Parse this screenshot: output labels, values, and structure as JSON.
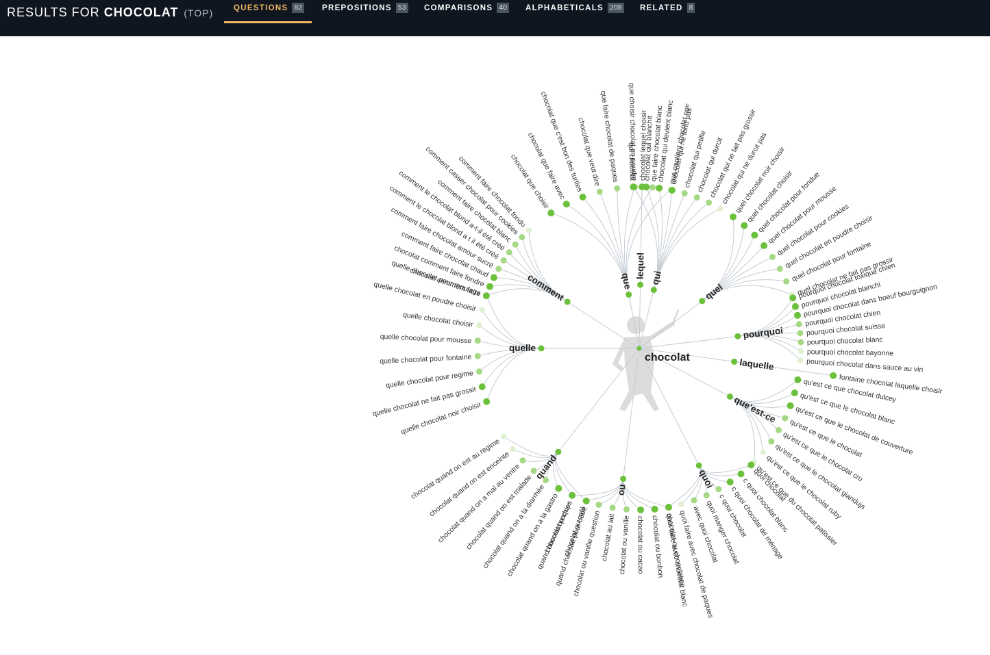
{
  "header": {
    "title_prefix": "RESULTS FOR",
    "query": "CHOCOLAT",
    "mode": "(TOP)",
    "tabs": [
      {
        "label": "QUESTIONS",
        "count": "82",
        "active": true
      },
      {
        "label": "PREPOSITIONS",
        "count": "53",
        "active": false
      },
      {
        "label": "COMPARISONS",
        "count": "40",
        "active": false
      },
      {
        "label": "ALPHABETICALS",
        "count": "208",
        "active": false
      },
      {
        "label": "RELATED",
        "count": "8",
        "active": false
      }
    ]
  },
  "colors": {
    "header_bg": "#0f1620",
    "accent": "#f4b863",
    "node_strong": "#6cc13c",
    "node_medium": "#a5d883",
    "node_light": "#e0f1d2",
    "link": "#c4cbd2"
  },
  "wheel": {
    "root": "chocolat",
    "branches": [
      {
        "label": "que",
        "leaves": [
          {
            "text": "chocolat que choisir",
            "strength": 1
          },
          {
            "text": "chocolat que faire avec",
            "strength": 1
          },
          {
            "text": "chocolat que c'est bon des turtles",
            "strength": 1
          },
          {
            "text": "chocolat que veut dire",
            "strength": 2
          },
          {
            "text": "que faire chocolat de paques",
            "strength": 2
          },
          {
            "text": "que choisir chocolat en poudre",
            "strength": 2
          },
          {
            "text": "que faire chocolat blanc",
            "strength": 2
          },
          {
            "text": "que contient chocolat noir",
            "strength": 3
          }
        ]
      },
      {
        "label": "lequel",
        "leaves": [
          {
            "text": "chocolat lequel choisir",
            "strength": 1
          }
        ]
      },
      {
        "label": "qui",
        "leaves": [
          {
            "text": "qui chocolat",
            "strength": 1
          },
          {
            "text": "chocolat qui blanchit",
            "strength": 1
          },
          {
            "text": "chocolat qui devient blanc",
            "strength": 1
          },
          {
            "text": "chocolat qui ne fond pas",
            "strength": 1
          },
          {
            "text": "chocolat qui petille",
            "strength": 2
          },
          {
            "text": "chocolat qui durcit",
            "strength": 2
          },
          {
            "text": "chocolat qui ne fait pas grossir",
            "strength": 2
          },
          {
            "text": "chocolat qui ne durcit pas",
            "strength": 3
          }
        ]
      },
      {
        "label": "quel",
        "leaves": [
          {
            "text": "quel chocolat noir choisir",
            "strength": 1
          },
          {
            "text": "quel chocolat choisir",
            "strength": 1
          },
          {
            "text": "quel chocolat pour fondue",
            "strength": 1
          },
          {
            "text": "quel chocolat pour mousse",
            "strength": 1
          },
          {
            "text": "quel chocolat pour cookies",
            "strength": 2
          },
          {
            "text": "quel chocolat en poudre choisir",
            "strength": 2
          },
          {
            "text": "quel chocolat pour fontaine",
            "strength": 2
          },
          {
            "text": "quel chocolat ne fait pas grossir",
            "strength": 3
          }
        ]
      },
      {
        "label": "pourquoi",
        "leaves": [
          {
            "text": "pourquoi chocolat toxique chien",
            "strength": 1
          },
          {
            "text": "pourquoi chocolat blanchi",
            "strength": 1
          },
          {
            "text": "pourquoi chocolat dans boeuf bourguignon",
            "strength": 1
          },
          {
            "text": "pourquoi chocolat chien",
            "strength": 2
          },
          {
            "text": "pourquoi chocolat suisse",
            "strength": 2
          },
          {
            "text": "pourquoi chocolat blanc",
            "strength": 2
          },
          {
            "text": "pourquoi chocolat bayonne",
            "strength": 3
          },
          {
            "text": "pourquoi chocolat dans sauce au vin",
            "strength": 3
          }
        ]
      },
      {
        "label": "laquelle",
        "leaves": [
          {
            "text": "fontaine chocolat laquelle choisir",
            "strength": 1
          }
        ]
      },
      {
        "label": "que'est-ce",
        "leaves": [
          {
            "text": "qu'est ce que chocolat dulcey",
            "strength": 1
          },
          {
            "text": "qu'est ce que le chocolat blanc",
            "strength": 1
          },
          {
            "text": "qu'est ce que le chocolat de couverture",
            "strength": 1
          },
          {
            "text": "qu'est ce que le chocolat",
            "strength": 2
          },
          {
            "text": "qu'est ce que le chocolat cru",
            "strength": 2
          },
          {
            "text": "qu'est ce que le chocolat gianduja",
            "strength": 2
          },
          {
            "text": "qu'est ce que le chocolat ruby",
            "strength": 3
          },
          {
            "text": "qu'est ce que du chocolat patissier",
            "strength": 3
          }
        ]
      },
      {
        "label": "quoi",
        "leaves": [
          {
            "text": "quoi chocolat",
            "strength": 1
          },
          {
            "text": "c quoi chocolat blanc",
            "strength": 1
          },
          {
            "text": "c quoi chocolat de ménage",
            "strength": 1
          },
          {
            "text": "c quoi chocolat",
            "strength": 2
          },
          {
            "text": "quoi manger chocolat",
            "strength": 2
          },
          {
            "text": "avec quoi chocolat",
            "strength": 2
          },
          {
            "text": "quoi faire avec chocolat de paques",
            "strength": 3
          },
          {
            "text": "quoi faire avec chocolat blanc",
            "strength": 3
          }
        ]
      },
      {
        "label": "ou",
        "leaves": [
          {
            "text": "chocolat ou chocolatine",
            "strength": 1
          },
          {
            "text": "chocolat ou bonbon",
            "strength": 1
          },
          {
            "text": "chocolat ou cacao",
            "strength": 1
          },
          {
            "text": "chocolat ou vanille",
            "strength": 2
          },
          {
            "text": "chocolat au lait",
            "strength": 2
          },
          {
            "text": "chocolat ou vanille question",
            "strength": 2
          },
          {
            "text": "chocolat ou café",
            "strength": 3
          },
          {
            "text": "chocolat ou chips",
            "strength": 3
          }
        ]
      },
      {
        "label": "quand",
        "leaves": [
          {
            "text": "quand chocolat pour bébé",
            "strength": 1
          },
          {
            "text": "quand chocolat paques",
            "strength": 1
          },
          {
            "text": "chocolat quand on a la gastro",
            "strength": 1
          },
          {
            "text": "chocolat quand on a la diarrhée",
            "strength": 2
          },
          {
            "text": "chocolat quand on est malade",
            "strength": 2
          },
          {
            "text": "chocolat quand on a mal au ventre",
            "strength": 2
          },
          {
            "text": "chocolat quand on est enceinte",
            "strength": 3
          },
          {
            "text": "chocolat quand on est au regime",
            "strength": 3
          }
        ]
      },
      {
        "label": "quelle",
        "leaves": [
          {
            "text": "quelle chocolat noir choisir",
            "strength": 1
          },
          {
            "text": "quelle chocolat ne fait pas grossir",
            "strength": 1
          },
          {
            "text": "quelle chocolat pour regime",
            "strength": 2
          },
          {
            "text": "quelle chocolat pour fontaine",
            "strength": 2
          },
          {
            "text": "quelle chocolat pour mousse",
            "strength": 2
          },
          {
            "text": "quelle chocolat choisir",
            "strength": 3
          },
          {
            "text": "quelle chocolat en poudre choisir",
            "strength": 3
          },
          {
            "text": "quelle chocolat pour moulage",
            "strength": 3
          }
        ]
      },
      {
        "label": "comment",
        "leaves": [
          {
            "text": "chocolat comment faire",
            "strength": 1
          },
          {
            "text": "chocolat comment faire fondre",
            "strength": 1
          },
          {
            "text": "comment faire chocolat chaud",
            "strength": 1
          },
          {
            "text": "comment faire chocolat amour sucré",
            "strength": 2
          },
          {
            "text": "comment le chocolat blond a t il été créé",
            "strength": 2
          },
          {
            "text": "comment le chocolat blond a-t-il été créé",
            "strength": 2
          },
          {
            "text": "comment faire chocolat blanc",
            "strength": 2
          },
          {
            "text": "comment casser chocolat pour cookies",
            "strength": 2
          },
          {
            "text": "comment faire chocolat fondu",
            "strength": 3
          }
        ]
      }
    ]
  }
}
